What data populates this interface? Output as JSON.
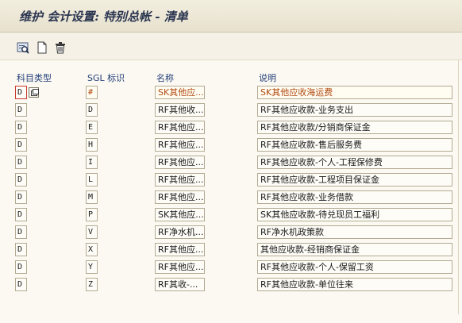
{
  "window": {
    "title": "维护 会计设置: 特别总帐 - 清单"
  },
  "toolbar": {
    "icons": [
      "find-icon",
      "new-document-icon",
      "delete-icon"
    ]
  },
  "columns": {
    "account_type": "科目类型",
    "sgl_indicator": "SGL 标识",
    "name": "名称",
    "description": "说明"
  },
  "rows": [
    {
      "account_type": "D",
      "sgl": "#",
      "name": "SK其他应...",
      "description": "SK其他应收海运费"
    },
    {
      "account_type": "D",
      "sgl": "D",
      "name": "RF其他收...",
      "description": "RF其他应收款-业务支出"
    },
    {
      "account_type": "D",
      "sgl": "E",
      "name": "RF其他应...",
      "description": "RF其他应收款/分销商保证金"
    },
    {
      "account_type": "D",
      "sgl": "H",
      "name": "RF其他应...",
      "description": "RF其他应收款-售后服务费"
    },
    {
      "account_type": "D",
      "sgl": "I",
      "name": "RF其他应...",
      "description": "RF其他应收款-个人-工程保修费"
    },
    {
      "account_type": "D",
      "sgl": "L",
      "name": "RF其他应...",
      "description": "RF其他应收款-工程项目保证金"
    },
    {
      "account_type": "D",
      "sgl": "M",
      "name": "RF其他应...",
      "description": "RF其他应收款-业务借款"
    },
    {
      "account_type": "D",
      "sgl": "P",
      "name": "SK其他应...",
      "description": "SK其他应收款-待兑现员工福利"
    },
    {
      "account_type": "D",
      "sgl": "V",
      "name": "RF净水机...",
      "description": "RF净水机政策款"
    },
    {
      "account_type": "D",
      "sgl": "X",
      "name": "RF其他应...",
      "description": "其他应收款-经销商保证金"
    },
    {
      "account_type": "D",
      "sgl": "Y",
      "name": "RF其他应...",
      "description": "RF其他应收款-个人-保留工资"
    },
    {
      "account_type": "D",
      "sgl": "Z",
      "name": "RF其收-...",
      "description": "RF其他应收款-单位往来"
    }
  ],
  "colors": {
    "header_text": "#25407a",
    "focus_border": "#c83a2e",
    "highlight_text": "#b24a12"
  }
}
